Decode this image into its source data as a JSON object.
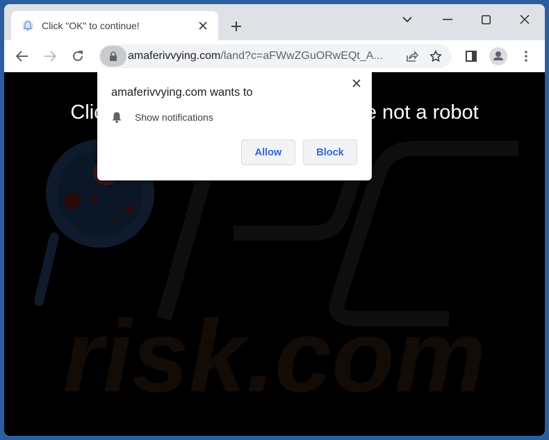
{
  "browser": {
    "tab": {
      "title": "Click \"OK\" to continue!",
      "favicon": "bell-favicon-icon"
    },
    "new_tab_label": "+",
    "window_controls": [
      "tab-search-icon",
      "minimize-icon",
      "maximize-icon",
      "close-icon"
    ],
    "address_bar": {
      "host": "amaferivvying.com",
      "path": "/land?c=aFWwZGuORwEQt_A..."
    },
    "toolbar_icons": [
      "back-icon",
      "forward-icon",
      "reload-icon",
      "lock-icon",
      "share-icon",
      "bookmark-star-icon",
      "side-panel-icon",
      "profile-icon",
      "menu-icon"
    ]
  },
  "page": {
    "headline_left": "Click",
    "headline_right": "re not a robot",
    "watermark_text": "risk.com",
    "watermark_logo": "PC"
  },
  "permission_popup": {
    "title": "amaferivvying.com wants to",
    "permission": "Show notifications",
    "allow_label": "Allow",
    "block_label": "Block"
  },
  "colors": {
    "desktop": "#2b5e9e",
    "button_text": "#3367d6",
    "page_background": "#000000"
  }
}
